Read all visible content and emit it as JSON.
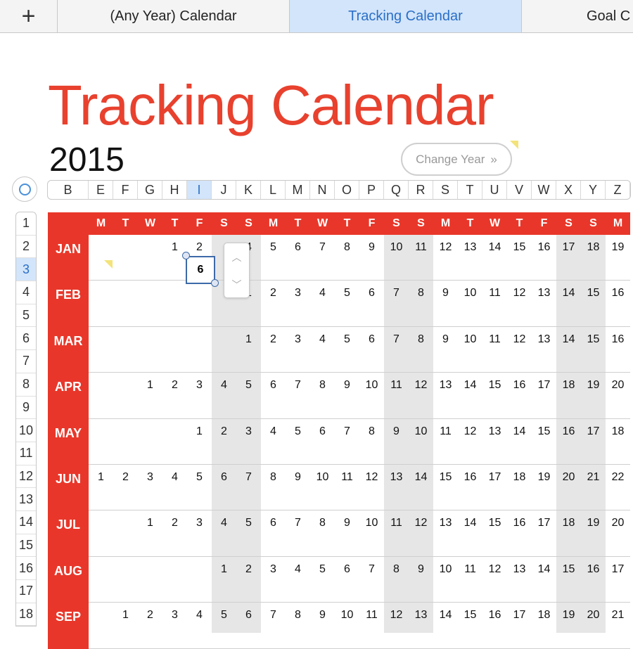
{
  "tabs": [
    {
      "label": "(Any Year) Calendar",
      "active": false
    },
    {
      "label": "Tracking Calendar",
      "active": true
    },
    {
      "label": "Goal C",
      "active": false
    }
  ],
  "add_sheet_icon": "plus-icon",
  "title": "Tracking Calendar",
  "year": "2015",
  "change_year": {
    "label": "Change Year",
    "icon": "»"
  },
  "column_headers": [
    "B",
    "E",
    "F",
    "G",
    "H",
    "I",
    "J",
    "K",
    "L",
    "M",
    "N",
    "O",
    "P",
    "Q",
    "R",
    "S",
    "T",
    "U",
    "V",
    "W",
    "X",
    "Y",
    "Z"
  ],
  "selected_column": "I",
  "row_headers": [
    "1",
    "2",
    "3",
    "4",
    "5",
    "6",
    "7",
    "8",
    "9",
    "10",
    "11",
    "12",
    "13",
    "14",
    "15",
    "16",
    "17",
    "18"
  ],
  "selected_row": "3",
  "weekdays": [
    "M",
    "T",
    "W",
    "T",
    "F",
    "S",
    "S",
    "M",
    "T",
    "W",
    "T",
    "F",
    "S",
    "S",
    "M",
    "T",
    "W",
    "T",
    "F",
    "S",
    "S",
    "M"
  ],
  "weekend_columns": [
    5,
    6,
    12,
    13,
    19,
    20
  ],
  "months": [
    {
      "name": "JAN",
      "days": [
        "",
        "",
        "",
        "1",
        "2",
        "3",
        "4",
        "5",
        "6",
        "7",
        "8",
        "9",
        "10",
        "11",
        "12",
        "13",
        "14",
        "15",
        "16",
        "17",
        "18",
        "19"
      ]
    },
    {
      "name": "FEB",
      "days": [
        "",
        "",
        "",
        "",
        "",
        "",
        "1",
        "2",
        "3",
        "4",
        "5",
        "6",
        "7",
        "8",
        "9",
        "10",
        "11",
        "12",
        "13",
        "14",
        "15",
        "16"
      ]
    },
    {
      "name": "MAR",
      "days": [
        "",
        "",
        "",
        "",
        "",
        "",
        "1",
        "2",
        "3",
        "4",
        "5",
        "6",
        "7",
        "8",
        "9",
        "10",
        "11",
        "12",
        "13",
        "14",
        "15",
        "16"
      ]
    },
    {
      "name": "APR",
      "days": [
        "",
        "",
        "1",
        "2",
        "3",
        "4",
        "5",
        "6",
        "7",
        "8",
        "9",
        "10",
        "11",
        "12",
        "13",
        "14",
        "15",
        "16",
        "17",
        "18",
        "19",
        "20"
      ]
    },
    {
      "name": "MAY",
      "days": [
        "",
        "",
        "",
        "",
        "1",
        "2",
        "3",
        "4",
        "5",
        "6",
        "7",
        "8",
        "9",
        "10",
        "11",
        "12",
        "13",
        "14",
        "15",
        "16",
        "17",
        "18"
      ]
    },
    {
      "name": "JUN",
      "days": [
        "1",
        "2",
        "3",
        "4",
        "5",
        "6",
        "7",
        "8",
        "9",
        "10",
        "11",
        "12",
        "13",
        "14",
        "15",
        "16",
        "17",
        "18",
        "19",
        "20",
        "21",
        "22"
      ]
    },
    {
      "name": "JUL",
      "days": [
        "",
        "",
        "1",
        "2",
        "3",
        "4",
        "5",
        "6",
        "7",
        "8",
        "9",
        "10",
        "11",
        "12",
        "13",
        "14",
        "15",
        "16",
        "17",
        "18",
        "19",
        "20"
      ]
    },
    {
      "name": "AUG",
      "days": [
        "",
        "",
        "",
        "",
        "",
        "1",
        "2",
        "3",
        "4",
        "5",
        "6",
        "7",
        "8",
        "9",
        "10",
        "11",
        "12",
        "13",
        "14",
        "15",
        "16",
        "17"
      ]
    },
    {
      "name": "SEP",
      "days": [
        "",
        "1",
        "2",
        "3",
        "4",
        "5",
        "6",
        "7",
        "8",
        "9",
        "10",
        "11",
        "12",
        "13",
        "14",
        "15",
        "16",
        "17",
        "18",
        "19",
        "20",
        "21"
      ]
    }
  ],
  "selected_cell": {
    "value": "6"
  },
  "colors": {
    "accent": "#e8372a",
    "selection": "#d3e5fa",
    "weekend": "#e6e6e6"
  }
}
